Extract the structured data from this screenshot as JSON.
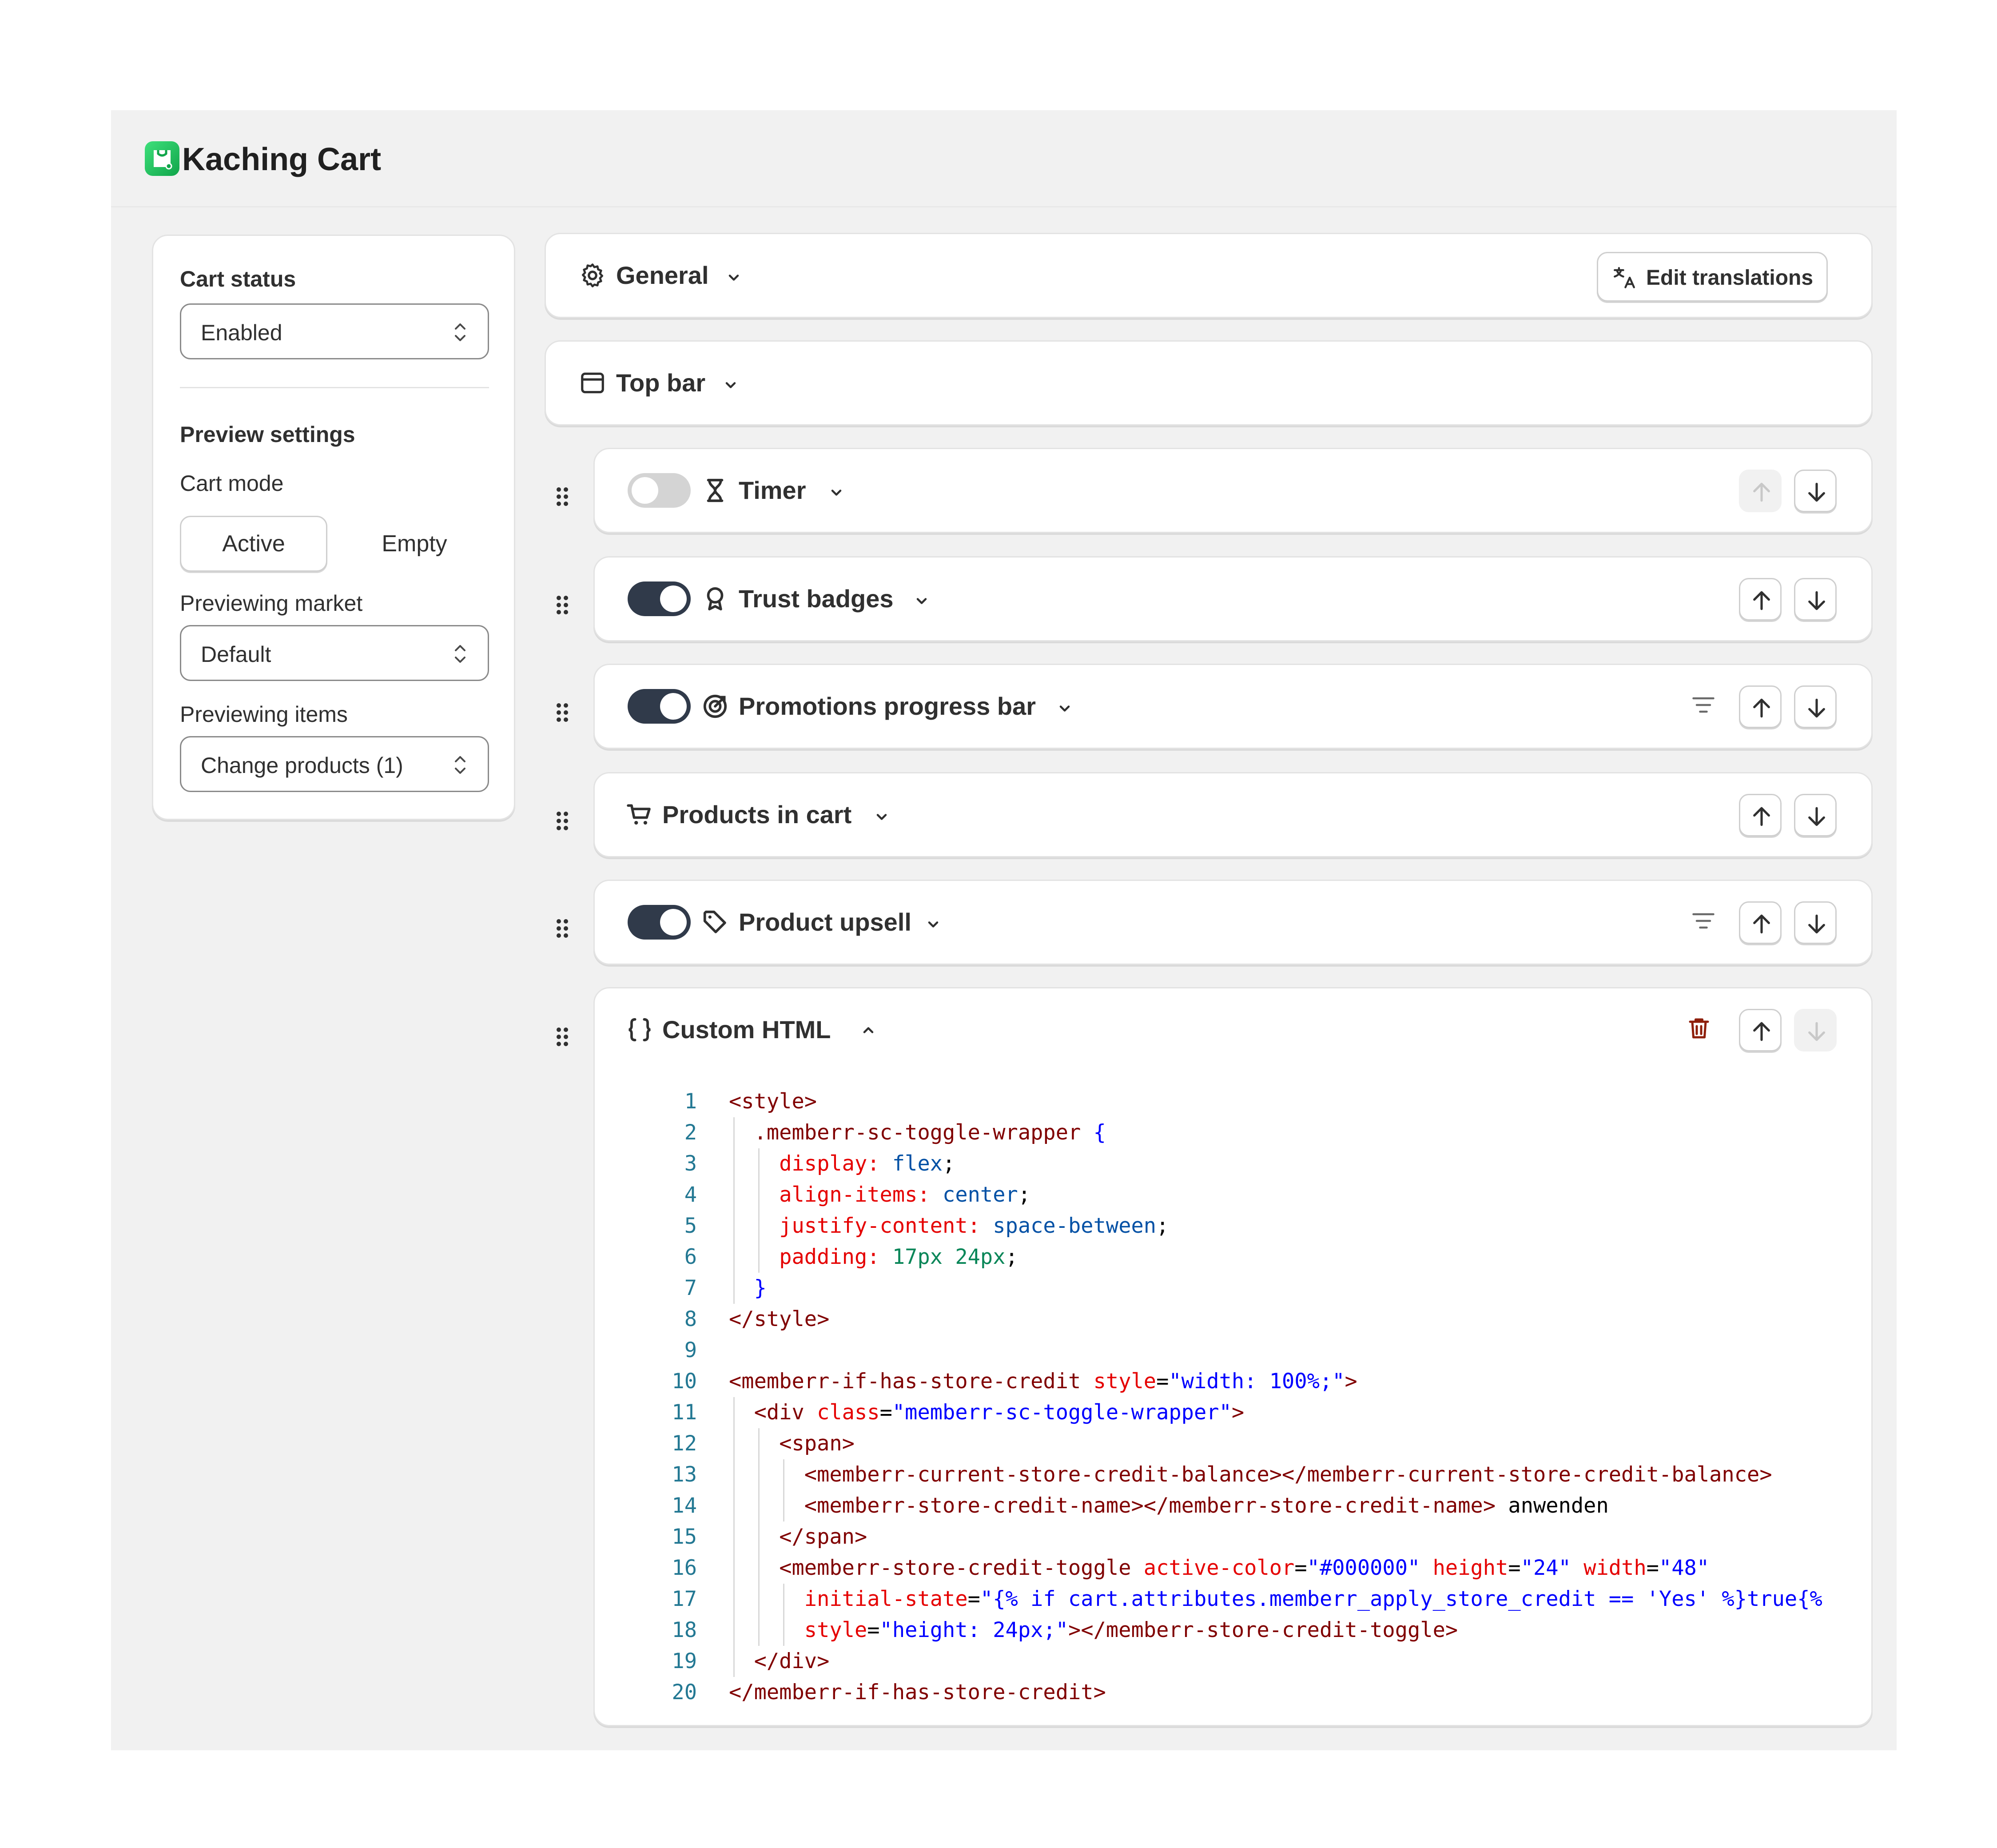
{
  "app": {
    "title": "Kaching Cart"
  },
  "left_panel": {
    "cart_status_label": "Cart status",
    "cart_status_value": "Enabled",
    "preview_settings_label": "Preview settings",
    "cart_mode_label": "Cart mode",
    "cart_mode_options": [
      "Active",
      "Empty"
    ],
    "cart_mode_selected": "Active",
    "previewing_market_label": "Previewing market",
    "previewing_market_value": "Default",
    "previewing_items_label": "Previewing items",
    "previewing_items_value": "Change products (1)"
  },
  "sections": {
    "general": {
      "title": "General",
      "edit_translations_label": "Edit translations"
    },
    "top_bar": {
      "title": "Top bar"
    },
    "timer": {
      "title": "Timer",
      "enabled": false
    },
    "trust_badges": {
      "title": "Trust badges",
      "enabled": true
    },
    "promotions_progress_bar": {
      "title": "Promotions progress bar",
      "enabled": true
    },
    "products_in_cart": {
      "title": "Products in cart"
    },
    "product_upsell": {
      "title": "Product upsell",
      "enabled": true
    },
    "custom_html": {
      "title": "Custom HTML"
    }
  },
  "code_editor": {
    "lines": [
      {
        "n": "1",
        "t": "<style>"
      },
      {
        "n": "2",
        "t": "  .memberr-sc-toggle-wrapper {"
      },
      {
        "n": "3",
        "t": "    display: flex;"
      },
      {
        "n": "4",
        "t": "    align-items: center;"
      },
      {
        "n": "5",
        "t": "    justify-content: space-between;"
      },
      {
        "n": "6",
        "t": "    padding: 17px 24px;"
      },
      {
        "n": "7",
        "t": "  }"
      },
      {
        "n": "8",
        "t": "</style>"
      },
      {
        "n": "9",
        "t": ""
      },
      {
        "n": "10",
        "t": "<memberr-if-has-store-credit style=\"width: 100%;\">"
      },
      {
        "n": "11",
        "t": "  <div class=\"memberr-sc-toggle-wrapper\">"
      },
      {
        "n": "12",
        "t": "    <span>"
      },
      {
        "n": "13",
        "t": "      <memberr-current-store-credit-balance></memberr-current-store-credit-balance>"
      },
      {
        "n": "14",
        "t": "      <memberr-store-credit-name></memberr-store-credit-name> anwenden"
      },
      {
        "n": "15",
        "t": "    </span>"
      },
      {
        "n": "16",
        "t": "    <memberr-store-credit-toggle active-color=\"#000000\" height=\"24\" width=\"48\""
      },
      {
        "n": "17",
        "t": "      initial-state=\"{% if cart.attributes.memberr_apply_store_credit == 'Yes' %}true{%"
      },
      {
        "n": "18",
        "t": "      style=\"height: 24px;\"></memberr-store-credit-toggle>"
      },
      {
        "n": "19",
        "t": "  </div>"
      },
      {
        "n": "20",
        "t": "</memberr-if-has-store-credit>"
      }
    ]
  },
  "colors": {
    "toggle_on": "#303a4a",
    "toggle_off": "#d4d4d4",
    "delete_icon": "#8e1f0b",
    "logo": "#10a54a",
    "code_line_number": "#237893"
  },
  "icons": [
    "gear-icon",
    "chevron-down-icon",
    "chevron-up-icon",
    "layout-icon",
    "hourglass-icon",
    "badge-icon",
    "target-icon",
    "cart-icon",
    "tag-icon",
    "code-braces-icon",
    "filter-icon",
    "arrow-up-icon",
    "arrow-down-icon",
    "trash-icon",
    "drag-handle-icon",
    "translate-icon",
    "select-chevron-icon"
  ]
}
